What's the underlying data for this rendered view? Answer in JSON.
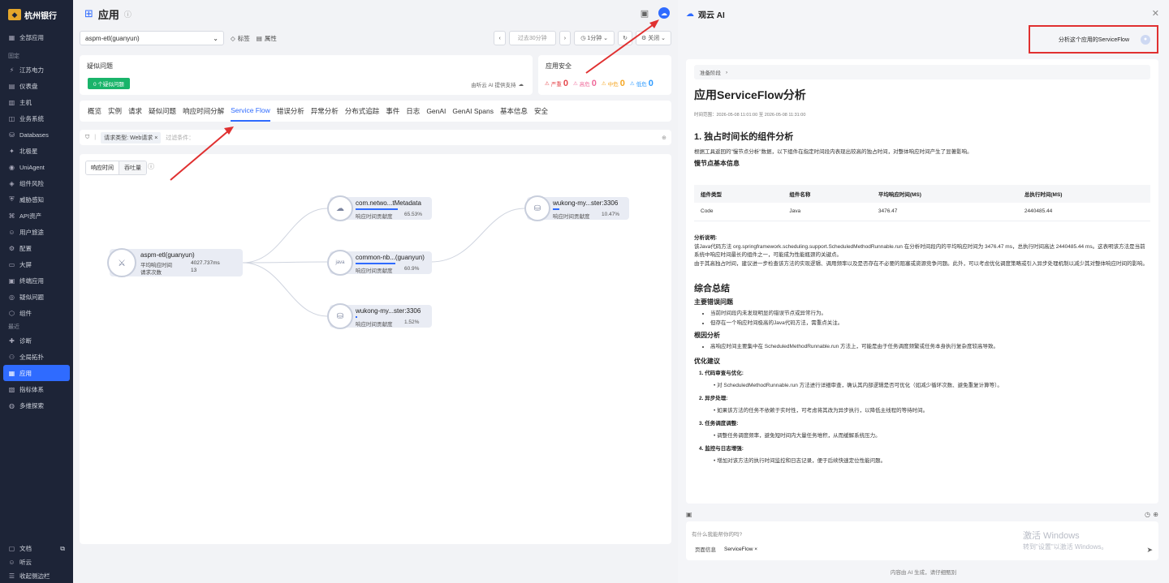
{
  "sidebar": {
    "brand": "杭州银行",
    "all_apps": "全部应用",
    "section_pinned": "固定",
    "items": [
      {
        "label": "江苏电力",
        "icon": "bolt-icon"
      },
      {
        "label": "仪表盘",
        "icon": "dashboard-icon"
      },
      {
        "label": "主机",
        "icon": "server-icon"
      },
      {
        "label": "业务系统",
        "icon": "system-icon"
      },
      {
        "label": "Databases",
        "icon": "database-icon"
      },
      {
        "label": "北极星",
        "icon": "star-icon"
      },
      {
        "label": "UniAgent",
        "icon": "agent-icon"
      },
      {
        "label": "组件风险",
        "icon": "risk-icon"
      },
      {
        "label": "威胁感知",
        "icon": "shield-icon"
      },
      {
        "label": "API资产",
        "icon": "api-icon"
      },
      {
        "label": "用户旅途",
        "icon": "user-icon"
      },
      {
        "label": "配置",
        "icon": "config-icon"
      },
      {
        "label": "大屏",
        "icon": "screen-icon"
      },
      {
        "label": "终端应用",
        "icon": "terminal-icon"
      },
      {
        "label": "疑似问题",
        "icon": "issue-icon"
      },
      {
        "label": "组件",
        "icon": "component-icon"
      }
    ],
    "section_recent": "最近",
    "recent": [
      {
        "label": "诊断",
        "icon": "diagnose-icon"
      },
      {
        "label": "全局拓扑",
        "icon": "topology-icon"
      },
      {
        "label": "应用",
        "icon": "app-icon",
        "active": true
      },
      {
        "label": "指标体系",
        "icon": "metrics-icon"
      },
      {
        "label": "多维探索",
        "icon": "explore-icon"
      }
    ],
    "bottom": [
      {
        "label": "文档",
        "icon": "doc-icon"
      },
      {
        "label": "听云",
        "icon": "user-icon"
      },
      {
        "label": "收起侧边栏",
        "icon": "collapse-icon"
      }
    ]
  },
  "header": {
    "title": "应用"
  },
  "toolbar": {
    "app_select": "aspm-etl(guanyun)",
    "tag_label": "标签",
    "attr_label": "属性",
    "time_range": "过去30分钟",
    "interval": "1分钟",
    "refresh_mode": "关闭"
  },
  "issues_card": {
    "title": "疑似问题",
    "badge": "0 个疑似问题",
    "powered_by": "由听云 AI 提供支持"
  },
  "security_card": {
    "title": "应用安全",
    "items": [
      {
        "label": "严重",
        "value": "0",
        "color": "#e5484d"
      },
      {
        "label": "高危",
        "value": "0",
        "color": "#ef6a9a"
      },
      {
        "label": "中危",
        "value": "0",
        "color": "#f5a623"
      },
      {
        "label": "低危",
        "value": "0",
        "color": "#2f9bff"
      }
    ]
  },
  "tabs": [
    "概览",
    "实例",
    "请求",
    "疑似问题",
    "响应时间分解",
    "Service Flow",
    "错误分析",
    "异常分析",
    "分布式追踪",
    "事件",
    "日志",
    "GenAI",
    "GenAI Spans",
    "基本信息",
    "安全"
  ],
  "active_tab": "Service Flow",
  "filter": {
    "chip": "请求类型: Web请求",
    "placeholder": "过滤条件："
  },
  "flow": {
    "seg_on": "响应时间",
    "seg_off": "吞吐量",
    "root": {
      "name": "aspm-etl(guanyun)",
      "avg_label": "平均响应时间",
      "avg_value": "4027.737ms",
      "count_label": "请求次数",
      "count_value": "13"
    },
    "contribution_label": "响应时间贡献度",
    "nodes": [
      {
        "name": "com.netwo...tMetadata",
        "value": "65.53%",
        "pct": 0.6553
      },
      {
        "name": "common-nb...(guanyun)",
        "value": "60.9%",
        "pct": 0.609
      },
      {
        "name": "wukong-my...ster:3306",
        "value": "1.52%",
        "pct": 0.0152
      },
      {
        "name": "wukong-my...ster:3306",
        "value": "10.47%",
        "pct": 0.1047
      }
    ]
  },
  "ai": {
    "title": "观云 AI",
    "user_message": "分析这个应用的ServiceFlow",
    "stage": "准备阶段",
    "answer_title": "应用ServiceFlow分析",
    "time_range": "时间范围：2026-05-08 11:01:00 至 2026-05-08 11:31:00",
    "h1": "1. 独占时间长的组件分析",
    "p1": "根据工具返回的\"慢节点分析\"数据，以下组件在指定时间段内表现出较高的独占时间，对整体响应时间产生了显著影响。",
    "h_basic": "慢节点基本信息",
    "table": {
      "headers": [
        "组件类型",
        "组件名称",
        "平均响应时间(MS)",
        "总执行时间(MS)"
      ],
      "rows": [
        [
          "Code",
          "Java",
          "3476.47",
          "2440485.44"
        ]
      ]
    },
    "h_desc": "分析说明:",
    "p2": "该Java代码方法 org.springframework.scheduling.support.ScheduledMethodRunnable.run 在分析时间段内的平均响应时间为 3476.47 ms，总执行时间高达 2440485.44 ms。这表明该方法是当前系统中响应时间最长的组件之一，可能成为性能瓶颈的关键点。",
    "p3": "由于其高独占时间，建议进一步检查该方法的实现逻辑、调用频率以及是否存在不必要的阻塞或资源竞争问题。此外，可以考虑优化调度策略或引入异步处理机制以减少其对整体响应时间的影响。",
    "h_summary": "综合总结",
    "h_errors": "主要错误问题",
    "errors": [
      "当前时间段内未发现明显的错误节点或异常行为。",
      "但存在一个响应时间极高的Java代码方法，需重点关注。"
    ],
    "h_root": "根因分析",
    "root_cause": [
      "高响应时间主要集中在 ScheduledMethodRunnable.run 方法上，可能是由于任务调度频繁或任务本身执行复杂度较高导致。"
    ],
    "h_opt": "优化建议",
    "suggestions": [
      {
        "title": "1. 代码审查与优化:",
        "detail": "对 ScheduledMethodRunnable.run 方法进行详细审查，确认其内部逻辑是否可优化（如减少循环次数、避免重复计算等）。"
      },
      {
        "title": "2. 异步处理:",
        "detail": "如果该方法的任务不依赖于实时性，可考虑将其改为异步执行，以降低主线程的等待时间。"
      },
      {
        "title": "3. 任务调度调整:",
        "detail": "调整任务调度频率，避免短时间内大量任务堆积，从而缓解系统压力。"
      },
      {
        "title": "4. 监控与日志增强:",
        "detail": "增加对该方法的执行时间监控和日志记录，便于后续快速定位性能问题。"
      }
    ],
    "input_placeholder": "有什么我能帮你的吗?",
    "ctx_page": "页面信息",
    "ctx_chip": "ServiceFlow",
    "disclaimer": "内容由 AI 生成，请仔细甄别"
  },
  "watermark": {
    "line1": "激活 Windows",
    "line2": "转到\"设置\"以激活 Windows。"
  }
}
